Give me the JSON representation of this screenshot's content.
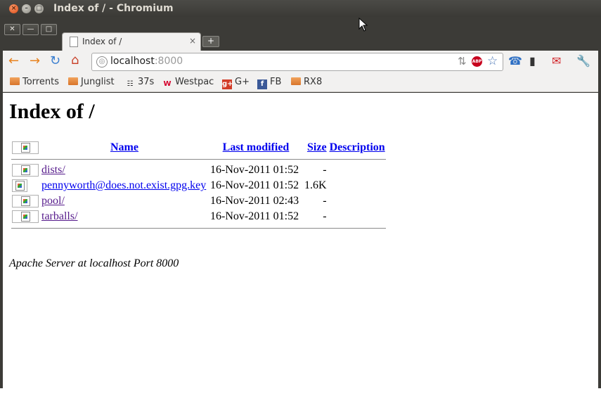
{
  "window": {
    "title": "Index of / - Chromium"
  },
  "tab": {
    "title": "Index of /",
    "close": "×",
    "new_tab": "+"
  },
  "frame_buttons": {
    "close": "✕",
    "minimize": "—",
    "maximize": "□"
  },
  "omnibox": {
    "host": "localhost",
    "port": ":8000",
    "abp_label": "ABP"
  },
  "bookmarks": [
    {
      "label": "Torrents",
      "icon": "folder-icon"
    },
    {
      "label": "Junglist",
      "icon": "folder-icon"
    },
    {
      "label": "37s",
      "icon": "37signals-icon"
    },
    {
      "label": "Westpac",
      "icon": "westpac-icon"
    },
    {
      "label": "G+",
      "icon": "google-plus-icon"
    },
    {
      "label": "FB",
      "icon": "facebook-icon"
    },
    {
      "label": "RX8",
      "icon": "folder-icon"
    }
  ],
  "page": {
    "heading": "Index of /",
    "columns": {
      "name": "Name",
      "modified": "Last modified",
      "size": "Size",
      "description": "Description"
    },
    "rows": [
      {
        "name": "dists/",
        "modified": "16-Nov-2011 01:52",
        "size": "-",
        "description": ""
      },
      {
        "name": "pennyworth@does.not.exist.gpg.key",
        "modified": "16-Nov-2011 01:52",
        "size": "1.6K",
        "description": ""
      },
      {
        "name": "pool/",
        "modified": "16-Nov-2011 02:43",
        "size": "-",
        "description": ""
      },
      {
        "name": "tarballs/",
        "modified": "16-Nov-2011 01:52",
        "size": "-",
        "description": ""
      }
    ],
    "footer": "Apache Server at localhost Port 8000"
  },
  "colors": {
    "link": "#0000ee",
    "visited": "#551a8b",
    "frame": "#3c3b37",
    "toolbar": "#f2f1f0"
  }
}
